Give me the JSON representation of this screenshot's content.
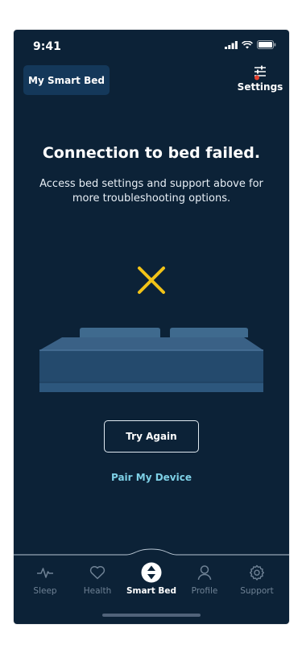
{
  "status_bar": {
    "time": "9:41"
  },
  "header": {
    "device_chip_label": "My Smart Bed",
    "settings_label": "Settings"
  },
  "message": {
    "title": "Connection to bed failed.",
    "subtitle": "Access bed settings and support above for more troubleshooting options."
  },
  "actions": {
    "try_again": "Try Again",
    "pair_device": "Pair My Device"
  },
  "tabs": [
    {
      "label": "Sleep",
      "icon": "pulse-icon"
    },
    {
      "label": "Health",
      "icon": "heart-icon"
    },
    {
      "label": "Smart Bed",
      "icon": "smart-bed-arrows-icon",
      "active": true
    },
    {
      "label": "Profile",
      "icon": "person-icon"
    },
    {
      "label": "Support",
      "icon": "gear-icon"
    }
  ],
  "colors": {
    "background": "#0c2237",
    "chip": "#14385a",
    "error_x": "#f2c318",
    "link": "#7ed0e6",
    "inactive_tab": "#6f8295",
    "notification_dot": "#e5412f"
  }
}
